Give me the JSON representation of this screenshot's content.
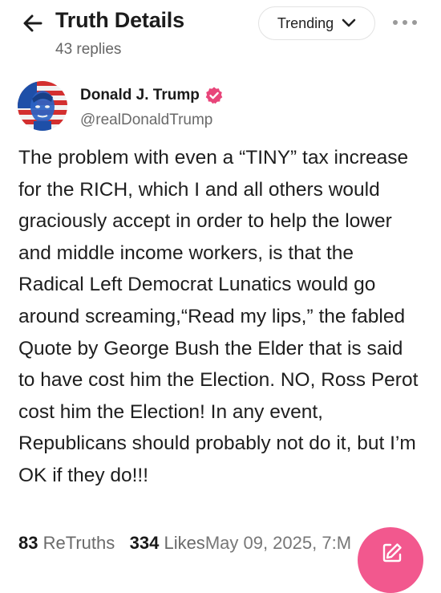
{
  "header": {
    "title": "Truth Details",
    "subtitle": "43 replies",
    "sort_label": "Trending"
  },
  "post": {
    "author_name": "Donald J. Trump",
    "author_handle": "@realDonaldTrump",
    "text": "The problem with even a “TINY” tax increase for the RICH, which I and all others would graciously accept in order to help the lower and middle income workers, is that the Radical Left Democrat Lunatics would go around screaming,“Read my lips,” the fabled Quote by George Bush the Elder that is said to have cost him the Election. NO, Ross Perot cost him the Election! In any event, Republicans should probably not do it, but I’m OK if they do!!!",
    "retruths_count": "83",
    "retruths_label": "ReTruths",
    "likes_count": "334",
    "likes_label": "Likes",
    "date": "May 09, 2025, 7:",
    "date_trailing": "M"
  },
  "colors": {
    "accent": "#f2588e",
    "verified": "#e8457a",
    "muted_text": "#6a6a6a"
  },
  "icons": {
    "back": "arrow-left-icon",
    "sort": "chevron-down-icon",
    "more": "more-horizontal-icon",
    "verified": "verified-badge-icon",
    "compose": "edit-pencil-icon"
  }
}
